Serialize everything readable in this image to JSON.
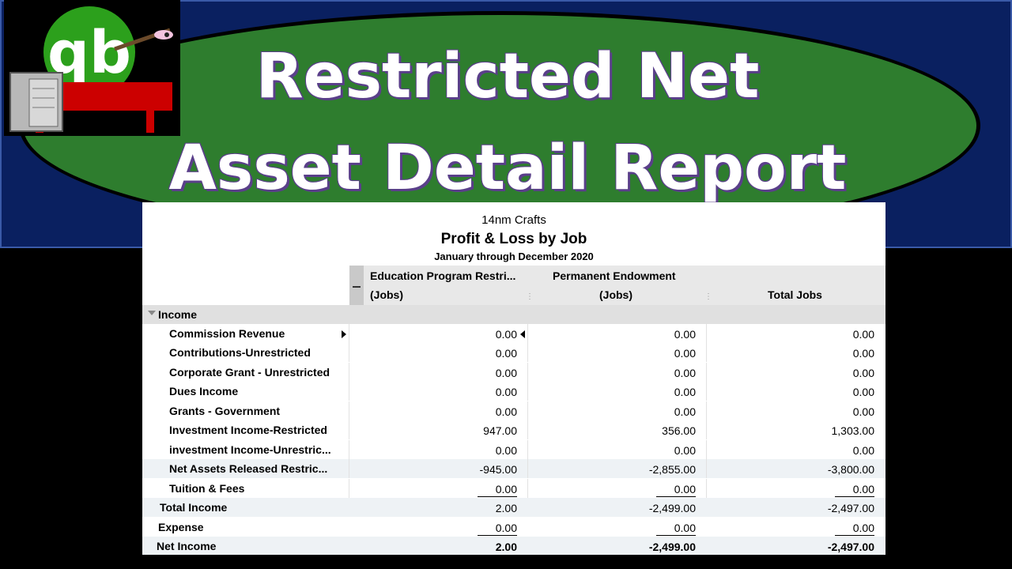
{
  "banner": {
    "title_line1": "Restricted Net",
    "title_line2": "Asset Detail Report",
    "colors": {
      "background": "#0a2060",
      "ellipse": "#2e7d2e",
      "title_text": "#ffffff"
    },
    "logo_icon": "quickbooks-logo-icon"
  },
  "report": {
    "company": "14nm Crafts",
    "title": "Profit & Loss by Job",
    "period": "January through December 2020",
    "columns": {
      "col1_line1": "Education Program Restri...",
      "col1_line2": "(Jobs)",
      "col2_line1": "Permanent Endowment",
      "col2_line2": "(Jobs)",
      "col3_line2": "Total Jobs"
    },
    "section_label": "Income",
    "rows": [
      {
        "name": "Commission Revenue",
        "c1": "0.00",
        "c2": "0.00",
        "c3": "0.00"
      },
      {
        "name": "Contributions-Unrestricted",
        "c1": "0.00",
        "c2": "0.00",
        "c3": "0.00"
      },
      {
        "name": "Corporate Grant - Unrestricted",
        "c1": "0.00",
        "c2": "0.00",
        "c3": "0.00"
      },
      {
        "name": "Dues Income",
        "c1": "0.00",
        "c2": "0.00",
        "c3": "0.00"
      },
      {
        "name": "Grants - Government",
        "c1": "0.00",
        "c2": "0.00",
        "c3": "0.00"
      },
      {
        "name": "Investment Income-Restricted",
        "c1": "947.00",
        "c2": "356.00",
        "c3": "1,303.00"
      },
      {
        "name": "investment Income-Unrestric...",
        "c1": "0.00",
        "c2": "0.00",
        "c3": "0.00"
      },
      {
        "name": "Net Assets Released Restric...",
        "c1": "-945.00",
        "c2": "-2,855.00",
        "c3": "-3,800.00"
      },
      {
        "name": "Tuition & Fees",
        "c1": "0.00",
        "c2": "0.00",
        "c3": "0.00"
      }
    ],
    "total_income": {
      "name": "Total Income",
      "c1": "2.00",
      "c2": "-2,499.00",
      "c3": "-2,497.00"
    },
    "expense": {
      "name": "Expense",
      "c1": "0.00",
      "c2": "0.00",
      "c3": "0.00"
    },
    "net_income": {
      "name": "Net Income",
      "c1": "2.00",
      "c2": "-2,499.00",
      "c3": "-2,497.00"
    }
  }
}
